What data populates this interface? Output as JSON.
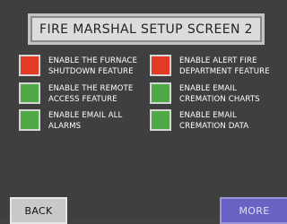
{
  "screen": {
    "title": "FIRE MARSHAL SETUP SCREEN 2"
  },
  "options": [
    {
      "state": "red",
      "label": "ENABLE THE FURNACE\nSHUTDOWN FEATURE"
    },
    {
      "state": "red",
      "label": "ENABLE ALERT FIRE\nDEPARTMENT FEATURE"
    },
    {
      "state": "green",
      "label": "ENABLE THE REMOTE\nACCESS FEATURE"
    },
    {
      "state": "green",
      "label": "ENABLE EMAIL\nCREMATION CHARTS"
    },
    {
      "state": "green",
      "label": "ENABLE EMAIL ALL\nALARMS"
    },
    {
      "state": "green",
      "label": "ENABLE EMAIL\nCREMATION DATA"
    }
  ],
  "buttons": {
    "back": "BACK",
    "more": "MORE"
  },
  "colors": {
    "background": "#3f3f3f",
    "red": "#e23a24",
    "green": "#4fa946",
    "more_button": "#6a63c6"
  }
}
